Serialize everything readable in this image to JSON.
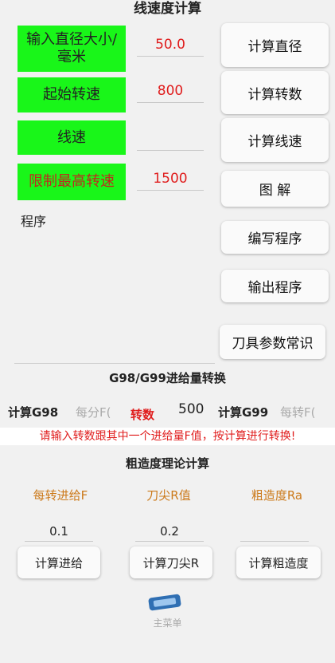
{
  "title": "线速度计算",
  "labels": {
    "diameter": "输入直径大小/毫米",
    "start_speed": "起始转速",
    "line_speed": "线速",
    "max_speed": "限制最高转速"
  },
  "values": {
    "diameter": "50.0",
    "start_speed": "800",
    "line_speed": "",
    "max_speed": "1500"
  },
  "buttons": {
    "calc_diameter": "计算直径",
    "calc_rpm": "计算转数",
    "calc_line_speed": "计算线速",
    "diagram": "图 解",
    "write_program": "编写程序",
    "output_program": "输出程序",
    "tool_params": "刀具参数常识"
  },
  "program_label": "程序",
  "g98_section": {
    "title": "G98/G99进给量转换",
    "calc_g98": "计算G98",
    "per_minute_placeholder": "每分F(",
    "rpm_label": "转数",
    "rpm_value": "500",
    "calc_g99": "计算G99",
    "per_rev_placeholder": "每转F(",
    "warning": "请输入转数跟其中一个进给量F值，按计算进行转换!"
  },
  "roughness_section": {
    "title": "粗造度理论计算",
    "feed_label": "每转进给F",
    "radius_label": "刀尖R值",
    "ra_label": "粗造度Ra",
    "feed_value": "0.1",
    "radius_value": "0.2",
    "ra_value": "",
    "calc_feed": "计算进给",
    "calc_radius": "计算刀尖R",
    "calc_ra": "计算粗造度"
  },
  "main_menu": "主菜单",
  "colors": {
    "label_bg": "#19f619",
    "value_red": "#e01d1d",
    "header_orange": "#cc7a1b"
  }
}
